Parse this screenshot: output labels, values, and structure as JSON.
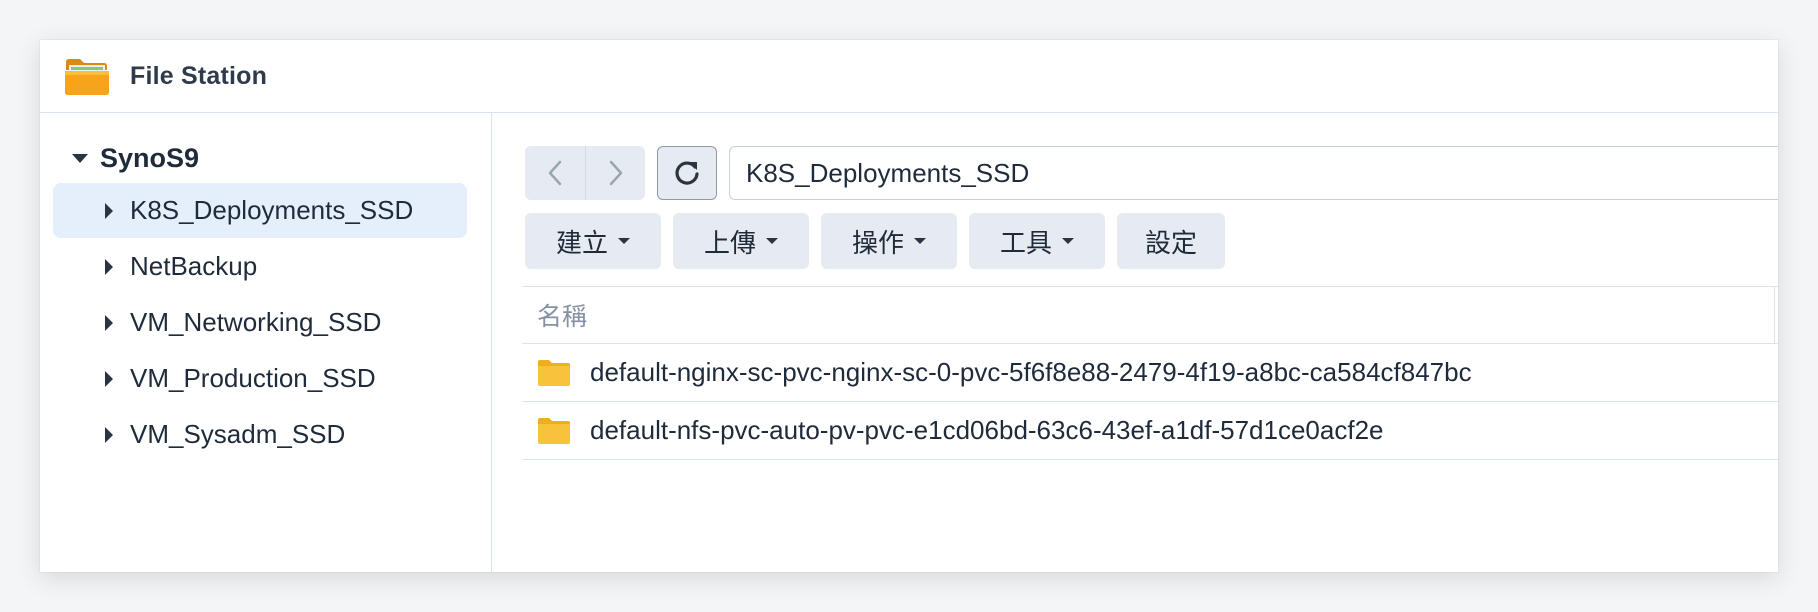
{
  "app": {
    "title": "File Station",
    "icon": "file-station-folder-icon"
  },
  "sidebar": {
    "root": "SynoS9",
    "items": [
      {
        "label": "K8S_Deployments_SSD",
        "selected": true
      },
      {
        "label": "NetBackup",
        "selected": false
      },
      {
        "label": "VM_Networking_SSD",
        "selected": false
      },
      {
        "label": "VM_Production_SSD",
        "selected": false
      },
      {
        "label": "VM_Sysadm_SSD",
        "selected": false
      }
    ]
  },
  "navigation": {
    "back_icon": "chevron-left-icon",
    "forward_icon": "chevron-right-icon",
    "refresh_icon": "refresh-icon",
    "path_value": "K8S_Deployments_SSD"
  },
  "toolbar": {
    "create_label": "建立",
    "upload_label": "上傳",
    "action_label": "操作",
    "tools_label": "工具",
    "settings_label": "設定"
  },
  "file_list": {
    "column_name": "名稱",
    "rows": [
      {
        "name": "default-nginx-sc-pvc-nginx-sc-0-pvc-5f6f8e88-2479-4f19-a8bc-ca584cf847bc",
        "type": "folder"
      },
      {
        "name": "default-nfs-pvc-auto-pv-pvc-e1cd06bd-63c6-43ef-a1df-57d1ce0acf2e",
        "type": "folder"
      }
    ]
  },
  "colors": {
    "selected_bg": "#e5eefb",
    "button_bg": "#e6ebf1",
    "folder_yellow": "#f9c23c"
  }
}
